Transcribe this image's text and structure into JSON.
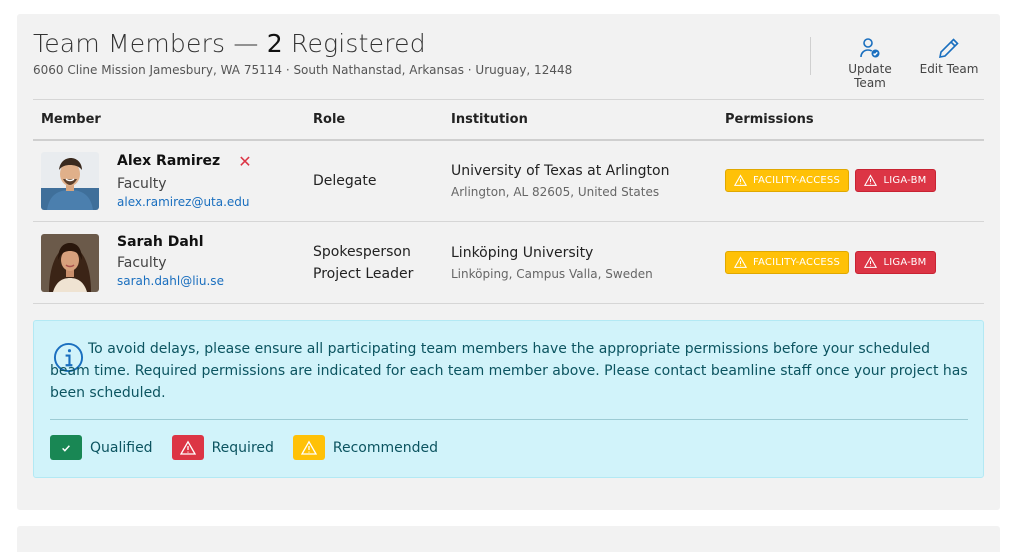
{
  "header": {
    "title_prefix": "Team Members — ",
    "count": "2",
    "title_suffix": " Registered",
    "address": "6060 Cline Mission Jamesbury, WA 75114 · South Nathanstad, Arkansas · Uruguay, 12448",
    "update_team_label": "Update Team",
    "edit_team_label": "Edit Team"
  },
  "table": {
    "headers": [
      "Member",
      "Role",
      "Institution",
      "Permissions"
    ],
    "rows": [
      {
        "name": "Alex Ramirez",
        "type": "Faculty",
        "email": "alex.ramirez@uta.edu",
        "roles": [
          "Delegate"
        ],
        "institution": "University of Texas at Arlington",
        "location": "Arlington, AL 82605, United States",
        "permissions": [
          {
            "label": "FACILITY-ACCESS",
            "status": "recommended"
          },
          {
            "label": "LIGA-BM",
            "status": "required"
          }
        ]
      },
      {
        "name": "Sarah Dahl",
        "type": "Faculty",
        "email": "sarah.dahl@liu.se",
        "roles": [
          "Spokesperson",
          "Project Leader"
        ],
        "institution": "Linköping University",
        "location": "Linköping, Campus Valla, Sweden",
        "permissions": [
          {
            "label": "FACILITY-ACCESS",
            "status": "recommended"
          },
          {
            "label": "LIGA-BM",
            "status": "required"
          }
        ]
      }
    ]
  },
  "notice": {
    "text": "To avoid delays, please ensure all participating team members have the appropriate permissions before your scheduled beam time. Required permissions are indicated for each team member above. Please contact beamline staff once your project has been scheduled.",
    "legend": {
      "qualified": "Qualified",
      "required": "Required",
      "recommended": "Recommended"
    }
  },
  "colors": {
    "required": "#dc3545",
    "recommended": "#ffc107",
    "qualified": "#198754",
    "link": "#1a6fbf",
    "info_bg": "#d1f3fa"
  }
}
